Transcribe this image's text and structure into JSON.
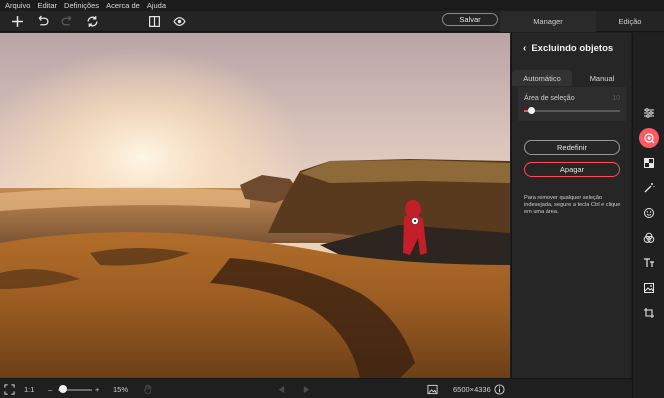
{
  "menu": [
    "Arquivo",
    "Editar",
    "Definições",
    "Acerca de",
    "Ajuda"
  ],
  "header": {
    "save_label": "Salvar",
    "manager_label": "Manager",
    "edit_label": "Edição"
  },
  "panel": {
    "title": "Excluindo objetos",
    "tabs": [
      "Automático",
      "Manual"
    ],
    "active_tab": "Automático",
    "area_label": "Área de seleção",
    "area_value": "10",
    "area_fraction": 0.08,
    "reset_label": "Redefinir",
    "erase_label": "Apagar",
    "help_text": "Para remover qualquer seleção indesejada, segure a tecla Ctrl e clique em uma área."
  },
  "status": {
    "ratio_label": "1:1",
    "zoom_minus": "–",
    "zoom_plus": "+",
    "zoom_percent": "15%",
    "image_size": "6500×4336"
  },
  "colors": {
    "accent": "#ff4d57",
    "panel_bg": "#262626",
    "app_bg": "#1e1e1e"
  },
  "tools": [
    "adjustments-icon",
    "object-eraser-icon",
    "crop-ratio-icon",
    "magic-wand-icon",
    "face-icon",
    "color-filter-icon",
    "text-icon",
    "image-insert-icon",
    "crop-icon"
  ]
}
